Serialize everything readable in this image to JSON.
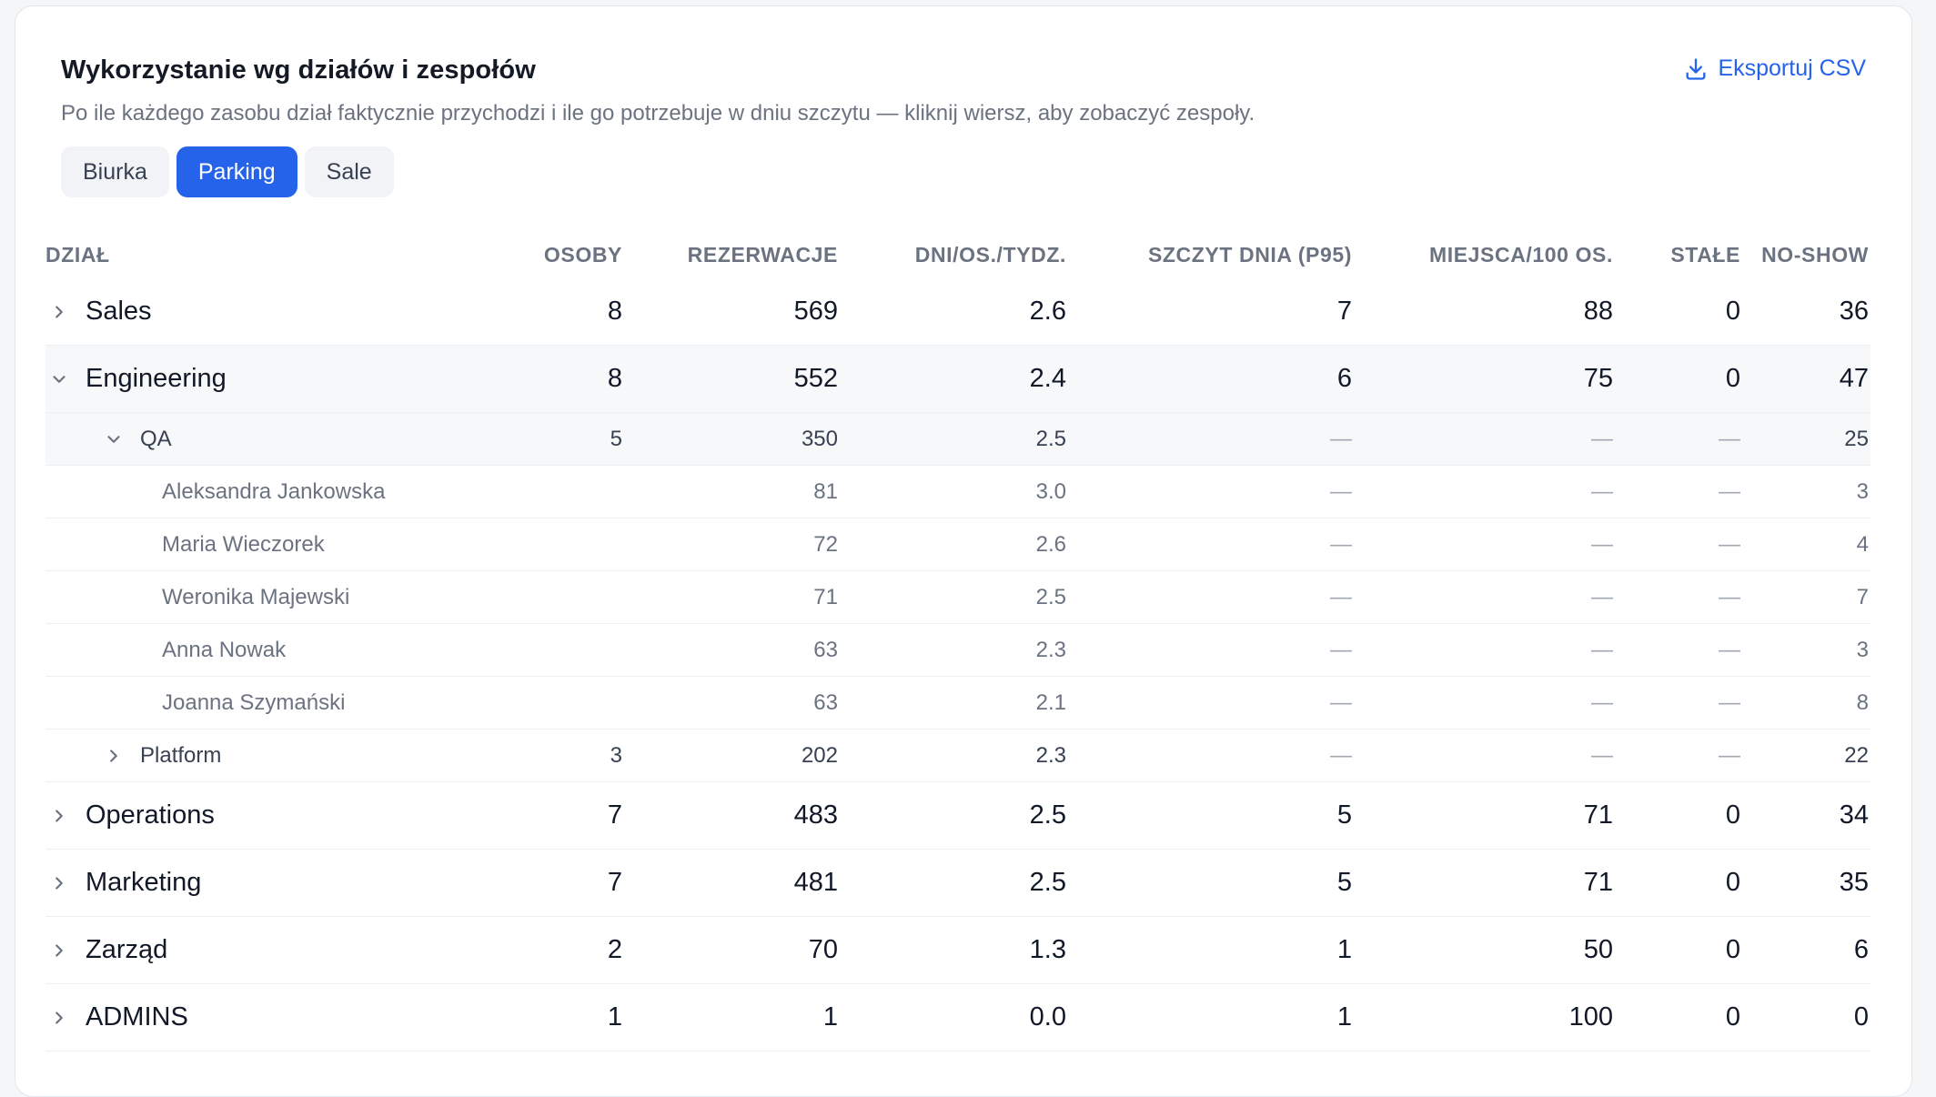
{
  "panel": {
    "title": "Wykorzystanie wg działów i zespołów",
    "subtitle": "Po ile każdego zasobu dział faktycznie przychodzi i ile go potrzebuje w dniu szczytu — kliknij wiersz, aby zobaczyć zespoły.",
    "export_label": "Eksportuj CSV",
    "export_icon": "download-icon"
  },
  "tabs": [
    {
      "label": "Biurka",
      "active": false
    },
    {
      "label": "Parking",
      "active": true
    },
    {
      "label": "Sale",
      "active": false
    }
  ],
  "columns": [
    "DZIAŁ",
    "OSOBY",
    "REZERWACJE",
    "DNI/OS./TYDZ.",
    "SZCZYT DNIA (P95)",
    "MIEJSCA/100 OS.",
    "STAŁE",
    "NO-SHOW"
  ],
  "rows": {
    "sales": {
      "name": "Sales",
      "osoby": "8",
      "rezerwacje": "569",
      "dni": "2.6",
      "szczyt": "7",
      "miejsca": "88",
      "stale": "0",
      "noshow": "36"
    },
    "engineering": {
      "name": "Engineering",
      "osoby": "8",
      "rezerwacje": "552",
      "dni": "2.4",
      "szczyt": "6",
      "miejsca": "75",
      "stale": "0",
      "noshow": "47"
    },
    "qa": {
      "name": "QA",
      "osoby": "5",
      "rezerwacje": "350",
      "dni": "2.5",
      "szczyt": "—",
      "miejsca": "—",
      "stale": "—",
      "noshow": "25"
    },
    "p1": {
      "name": "Aleksandra Jankowska",
      "rezerwacje": "81",
      "dni": "3.0",
      "szczyt": "—",
      "miejsca": "—",
      "stale": "—",
      "noshow": "3"
    },
    "p2": {
      "name": "Maria Wieczorek",
      "rezerwacje": "72",
      "dni": "2.6",
      "szczyt": "—",
      "miejsca": "—",
      "stale": "—",
      "noshow": "4"
    },
    "p3": {
      "name": "Weronika Majewski",
      "rezerwacje": "71",
      "dni": "2.5",
      "szczyt": "—",
      "miejsca": "—",
      "stale": "—",
      "noshow": "7"
    },
    "p4": {
      "name": "Anna Nowak",
      "rezerwacje": "63",
      "dni": "2.3",
      "szczyt": "—",
      "miejsca": "—",
      "stale": "—",
      "noshow": "3"
    },
    "p5": {
      "name": "Joanna Szymański",
      "rezerwacje": "63",
      "dni": "2.1",
      "szczyt": "—",
      "miejsca": "—",
      "stale": "—",
      "noshow": "8"
    },
    "platform": {
      "name": "Platform",
      "osoby": "3",
      "rezerwacje": "202",
      "dni": "2.3",
      "szczyt": "—",
      "miejsca": "—",
      "stale": "—",
      "noshow": "22"
    },
    "operations": {
      "name": "Operations",
      "osoby": "7",
      "rezerwacje": "483",
      "dni": "2.5",
      "szczyt": "5",
      "miejsca": "71",
      "stale": "0",
      "noshow": "34"
    },
    "marketing": {
      "name": "Marketing",
      "osoby": "7",
      "rezerwacje": "481",
      "dni": "2.5",
      "szczyt": "5",
      "miejsca": "71",
      "stale": "0",
      "noshow": "35"
    },
    "zarzad": {
      "name": "Zarząd",
      "osoby": "2",
      "rezerwacje": "70",
      "dni": "1.3",
      "szczyt": "1",
      "miejsca": "50",
      "stale": "0",
      "noshow": "6"
    },
    "admins": {
      "name": "ADMINS",
      "osoby": "1",
      "rezerwacje": "1",
      "dni": "0.0",
      "szczyt": "1",
      "miejsca": "100",
      "stale": "0",
      "noshow": "0"
    }
  },
  "colors": {
    "accent": "#2563eb",
    "muted_text": "#6b7280",
    "row_highlight": "#f7f8fa"
  }
}
